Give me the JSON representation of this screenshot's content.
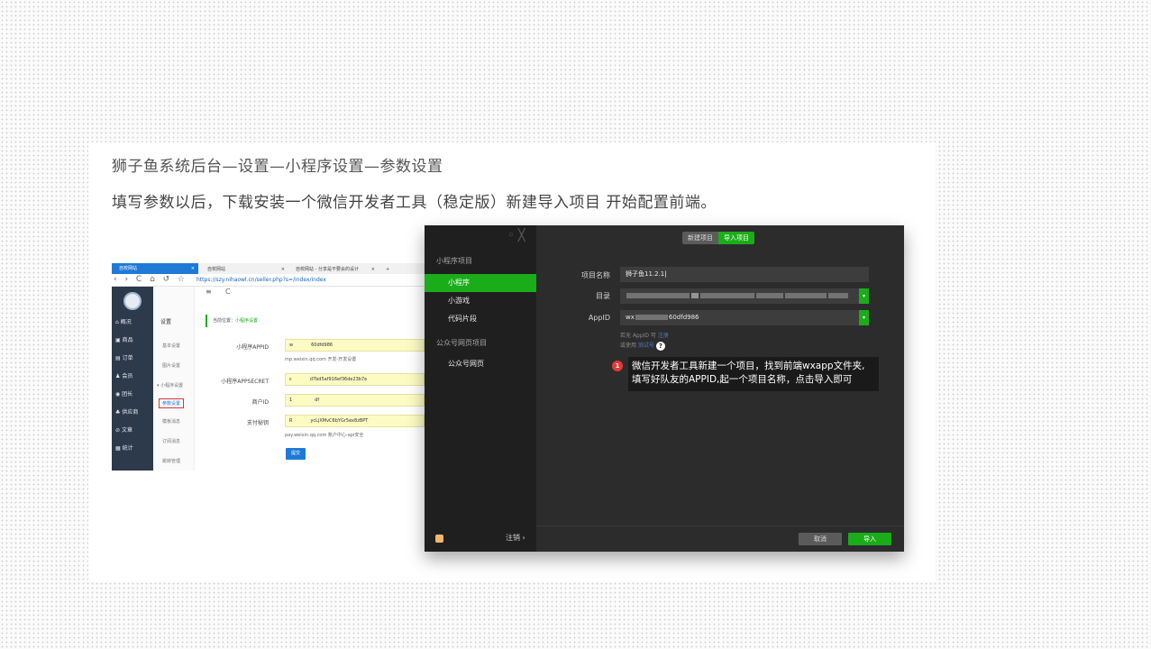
{
  "slide": {
    "heading": "狮子鱼系统后台—设置—小程序设置—参数设置",
    "subheading": "填写参数以后，下载安装一个微信开发者工具（稳定版）新建导入项目 开始配置前端。"
  },
  "browser": {
    "tabs": [
      {
        "label": "自校网站",
        "close": "×"
      },
      {
        "label": "自校网站",
        "close": "×"
      },
      {
        "label": "自校网站 - 分享是不要会的设计",
        "close": "×"
      },
      {
        "label": "+"
      }
    ],
    "nav_icons": "‹ › C ⌂ ↺ ☆",
    "url": "https://szy.nihaowl.cn/seller.php?s=/index/index",
    "toolbar_icons": [
      "≡",
      "C"
    ],
    "sidebar": [
      {
        "icon": "⌂",
        "label": "概况"
      },
      {
        "icon": "▣",
        "label": "商品"
      },
      {
        "icon": "▤",
        "label": "订单"
      },
      {
        "icon": "♟",
        "label": "会员"
      },
      {
        "icon": "◉",
        "label": "团长"
      },
      {
        "icon": "♣",
        "label": "供应商"
      },
      {
        "icon": "⊘",
        "label": "文章"
      },
      {
        "icon": "▦",
        "label": "统计"
      }
    ],
    "submenu": {
      "title": "设置",
      "items": [
        "基本设置",
        "图片设置",
        "▾ 小程序设置",
        "参数设置",
        "模板消息",
        "订阅消息",
        "跳转管理"
      ]
    },
    "breadcrumb": {
      "prefix": "当前位置：",
      "current": "小程序设置"
    },
    "form": [
      {
        "label": "小程序APPID",
        "value": "w　　　　60dfd986"
      },
      {
        "label": "小程序APPSECRET",
        "value": "c　　　　d7bd5af916ef36de23b7e"
      },
      {
        "label": "商户ID",
        "value": "1　　　　　df"
      },
      {
        "label": "支付秘钥",
        "value": "R　　　　ycLjXMvC6bYGr5ex8zBPT"
      }
    ],
    "notes": [
      "mp.weixin.qq.com 开发-开发设置",
      "pay.weixin.qq.com 账户中心-api安全"
    ],
    "submit_label": "提交"
  },
  "dialog": {
    "close_icons": "◦ ╳",
    "categories": [
      {
        "title": "小程序项目",
        "items": [
          {
            "label": "小程序",
            "active": true
          },
          {
            "label": "小游戏",
            "active": false
          },
          {
            "label": "代码片段",
            "active": false
          }
        ]
      },
      {
        "title": "公众号网页项目",
        "items": [
          {
            "label": "公众号网页",
            "active": false
          }
        ]
      }
    ],
    "logout_label": "注销 ›",
    "segments": {
      "new": "新建项目",
      "import": "导入项目"
    },
    "fields": [
      {
        "label": "项目名称",
        "value": "狮子鱼11.2.1"
      },
      {
        "label": "目录",
        "value": ""
      },
      {
        "label": "AppID",
        "value_prefix": "wx",
        "value_suffix": "60dfd986"
      }
    ],
    "hint1_text": "若无 AppID 可 ",
    "hint1_link": "注册",
    "hint2_text": "或使用 ",
    "hint2_link": "测试号",
    "qmark": "?",
    "annotation": {
      "badge": "1",
      "line1": "微信开发者工具新建一个项目，找到前端wxapp文件夹,",
      "line2": "填写好队友的APPID,起一个项目名称，点击导入即可"
    },
    "cancel_label": "取消",
    "import_label": "导入"
  },
  "colors": {
    "accent": "#1aad19",
    "dialog_bg": "#2c2c2c",
    "sidebar_bg": "#1f1f1f",
    "browser_sidebar": "#2d3a4b"
  }
}
